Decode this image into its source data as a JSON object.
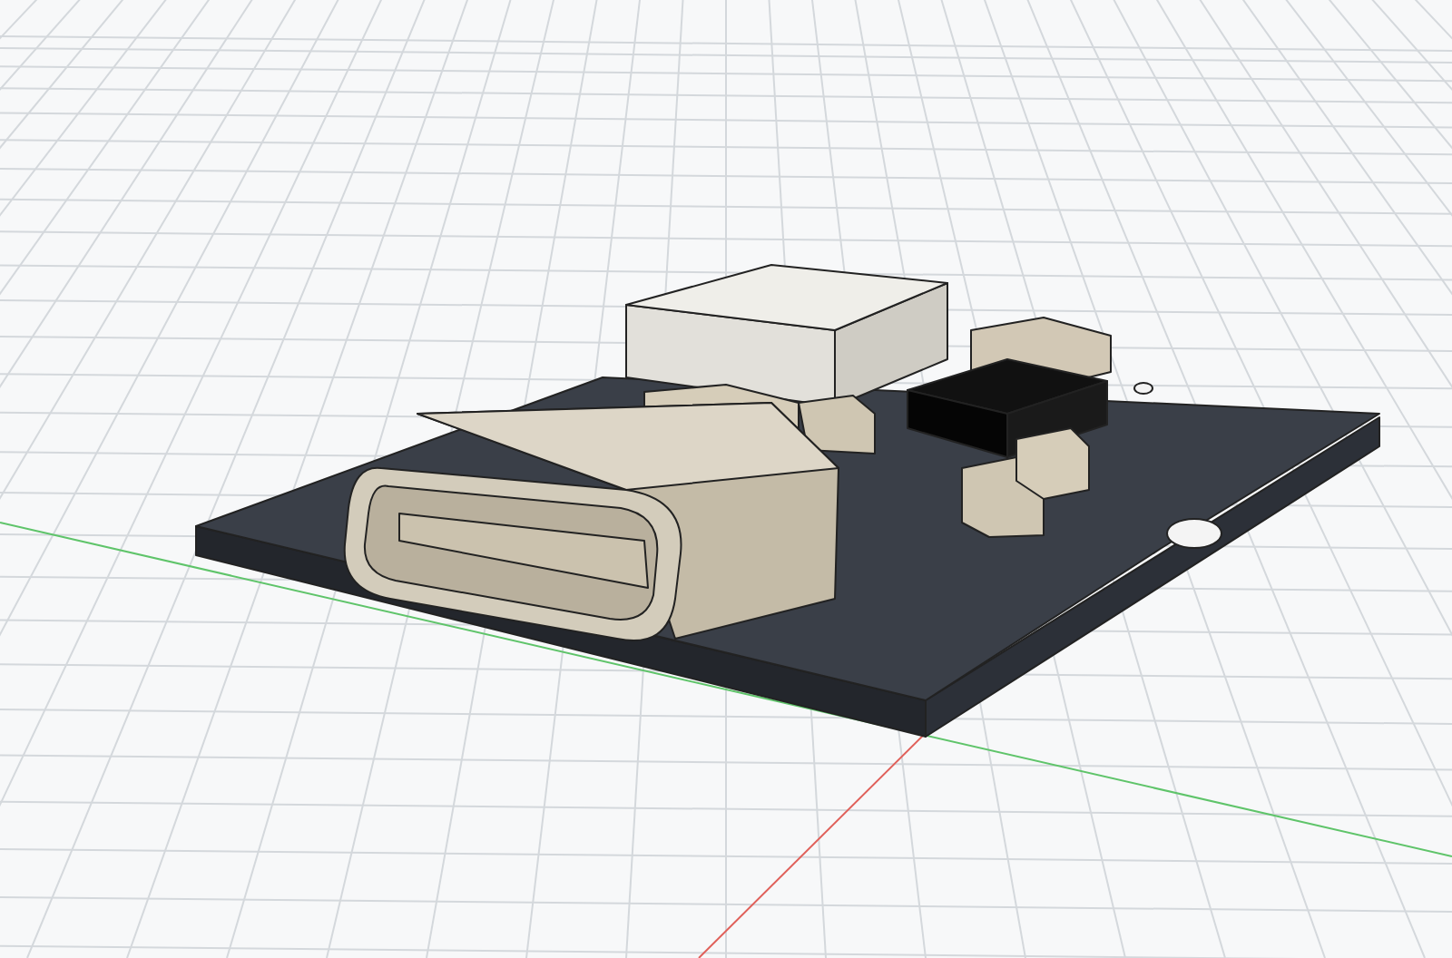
{
  "viewport": {
    "kind": "pcb-model"
  }
}
